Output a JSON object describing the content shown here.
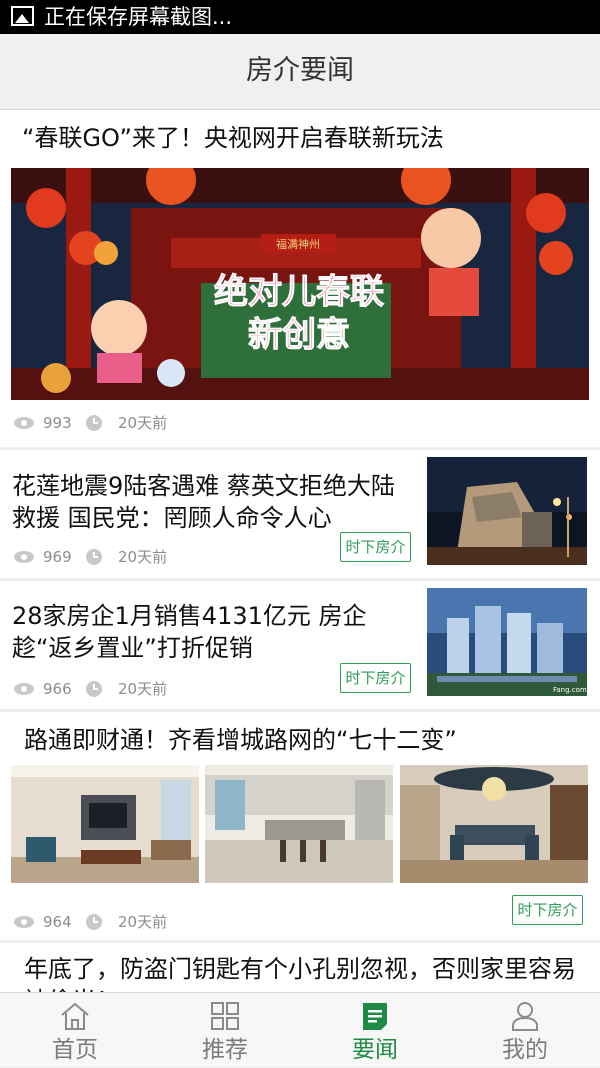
{
  "status_bar": {
    "text": "正在保存屏幕截图...",
    "icon": "image-icon"
  },
  "header": {
    "title": "房介要闻"
  },
  "articles": [
    {
      "title": "“春联GO”来了！央视网开启春联新玩法",
      "views": "993",
      "time": "20天前"
    },
    {
      "title": "花莲地震9陆客遇难 蔡英文拒绝大陆救援 国民党：罔顾人命令人心",
      "views": "969",
      "time": "20天前",
      "tag": "时下房介"
    },
    {
      "title": "28家房企1月销售4131亿元 房企趁“返乡置业”打折促销",
      "views": "966",
      "time": "20天前",
      "tag": "时下房介"
    },
    {
      "title": "路通即财通！齐看增城路网的“七十二变”",
      "views": "964",
      "time": "20天前",
      "tag": "时下房介"
    },
    {
      "title": "年底了，防盗门钥匙有个小孔别忽视，否则家里容易被偷光！"
    }
  ],
  "banner_text": {
    "sign": "福满神州",
    "line1": "绝对儿春联",
    "line2": "新创意",
    "watermark": "Fang.com"
  },
  "tabs": [
    {
      "label": "首页",
      "icon": "home-icon"
    },
    {
      "label": "推荐",
      "icon": "grid-icon"
    },
    {
      "label": "要闻",
      "icon": "news-icon"
    },
    {
      "label": "我的",
      "icon": "user-icon"
    }
  ],
  "colors": {
    "accent": "#2e9e57",
    "active_tab": "#1f8a46"
  }
}
